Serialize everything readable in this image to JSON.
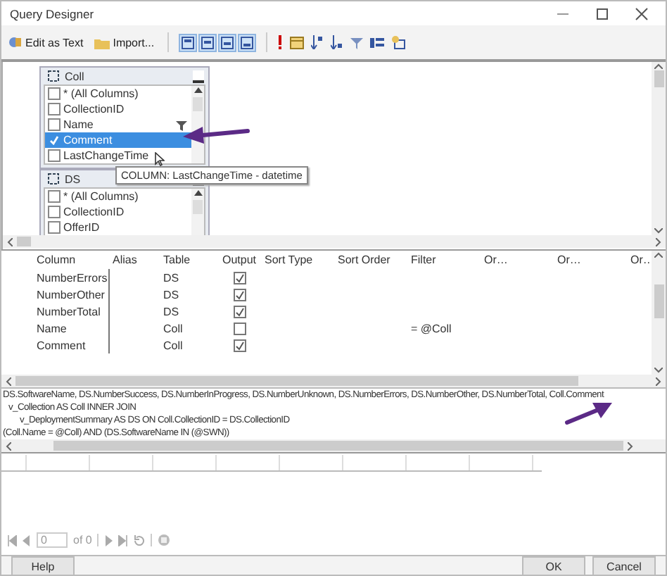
{
  "window": {
    "title": "Query Designer"
  },
  "toolbar": {
    "edit_as_text": "Edit as Text",
    "import": "Import...",
    "view_toggles": [
      {
        "selected": true
      },
      {
        "selected": true
      },
      {
        "selected": true
      },
      {
        "selected": true
      }
    ]
  },
  "diagram": {
    "tables": [
      {
        "name": "Coll",
        "columns": [
          {
            "label": "* (All Columns)",
            "checked": false,
            "selected": false,
            "filtered": false
          },
          {
            "label": "CollectionID",
            "checked": false,
            "selected": false,
            "filtered": false
          },
          {
            "label": "Name",
            "checked": false,
            "selected": false,
            "filtered": true
          },
          {
            "label": "Comment",
            "checked": true,
            "selected": true,
            "filtered": false
          },
          {
            "label": "LastChangeTime",
            "checked": false,
            "selected": false,
            "filtered": false
          }
        ]
      },
      {
        "name": "DS",
        "columns": [
          {
            "label": "* (All Columns)",
            "checked": false,
            "selected": false,
            "filtered": false
          },
          {
            "label": "CollectionID",
            "checked": false,
            "selected": false,
            "filtered": false
          },
          {
            "label": "OfferID",
            "checked": false,
            "selected": false,
            "filtered": false
          }
        ]
      }
    ],
    "tooltip": "COLUMN: LastChangeTime - datetime"
  },
  "grid": {
    "columns": [
      "Column",
      "Alias",
      "Table",
      "Output",
      "Sort Type",
      "Sort Order",
      "Filter",
      "Or…",
      "Or…",
      "Or…"
    ],
    "rows": [
      {
        "column": "NumberErrors",
        "table": "DS",
        "output": true
      },
      {
        "column": "NumberOther",
        "table": "DS",
        "output": true
      },
      {
        "column": "NumberTotal",
        "table": "DS",
        "output": true
      },
      {
        "column": "Name",
        "table": "Coll",
        "output": false,
        "filter": "= @Coll"
      },
      {
        "column": "Comment",
        "table": "Coll",
        "output": true
      }
    ]
  },
  "sql": [
    "DS.SoftwareName, DS.NumberSuccess, DS.NumberInProgress, DS.NumberUnknown, DS.NumberErrors, DS.NumberOther, DS.NumberTotal, Coll.Comment",
    "v_Collection AS Coll INNER JOIN",
    "v_DeploymentSummary AS DS ON Coll.CollectionID = DS.CollectionID",
    "(Coll.Name = @Coll) AND (DS.SoftwareName IN (@SWN))"
  ],
  "results": {
    "page": "0",
    "of": "of 0"
  },
  "buttons": {
    "help": "Help",
    "ok": "OK",
    "cancel": "Cancel"
  }
}
